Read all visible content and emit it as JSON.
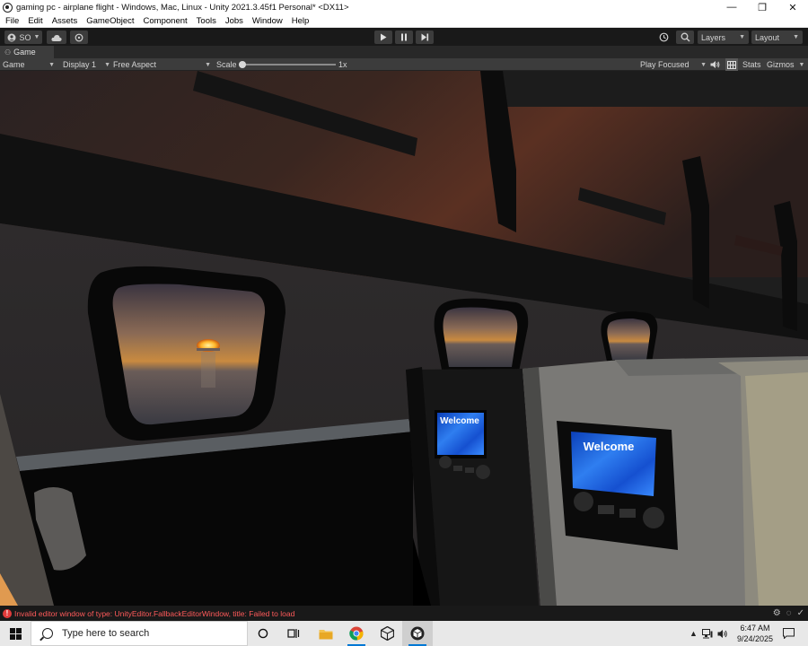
{
  "window": {
    "title": "gaming pc - airplane flight - Windows, Mac, Linux - Unity 2021.3.45f1 Personal* <DX11>",
    "minimize_glyph": "—",
    "maximize_glyph": "❐",
    "close_glyph": "✕"
  },
  "menu": [
    "File",
    "Edit",
    "Assets",
    "GameObject",
    "Component",
    "Tools",
    "Jobs",
    "Window",
    "Help"
  ],
  "toolbar": {
    "account_label": "SO",
    "layers_label": "Layers",
    "layout_label": "Layout"
  },
  "game_tab": {
    "label": "Game"
  },
  "game_toolbar": {
    "mode": "Game",
    "display": "Display 1",
    "aspect": "Free Aspect",
    "scale_label": "Scale",
    "scale_value": "1x",
    "scale_slider_level": 0.0,
    "play_mode": "Play Focused",
    "stats_label": "Stats",
    "gizmos_label": "Gizmos"
  },
  "scene": {
    "screen_text_1": "Welcome",
    "screen_text_2": "Welcome"
  },
  "console": {
    "message": "Invalid editor window of type: UnityEditor.FallbackEditorWindow, title: Failed to load"
  },
  "taskbar": {
    "search_placeholder": "Type here to search",
    "time": "6:47 AM",
    "date": "9/24/2025"
  },
  "colors": {
    "editor_bg": "#191919",
    "toolbar_bg": "#3c3c3c",
    "error_text": "#ff5a5a",
    "taskbar_bg": "#e8e8e8",
    "screen_blue": "#1f5fd6"
  }
}
